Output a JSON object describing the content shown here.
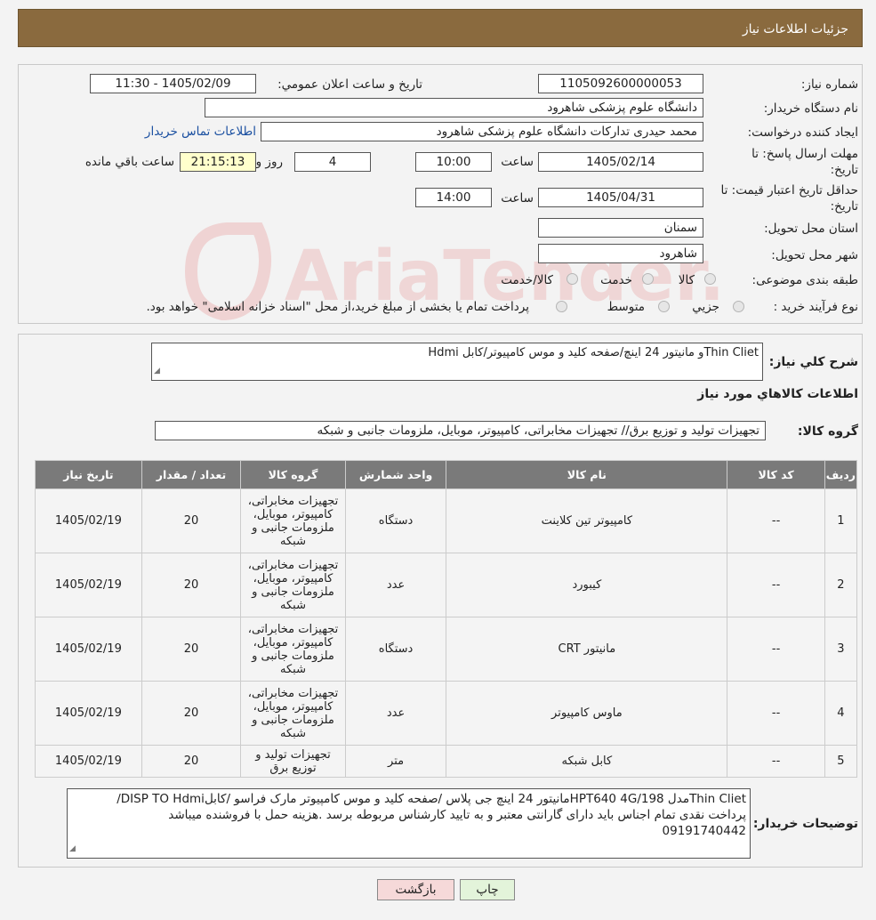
{
  "header": {
    "title": "جزئیات اطلاعات نیاز"
  },
  "form": {
    "need_number_label": "شماره نياز:",
    "need_number": "1105092600000053",
    "announce_label": "تاريخ و ساعت اعلان عمومي:",
    "announce_value": "1405/02/09 - 11:30",
    "buyer_org_label": "نام دستگاه خريدار:",
    "buyer_org": "دانشگاه علوم پزشکی شاهرود",
    "requester_label": "ايجاد کننده درخواست:",
    "requester": "محمد حیدری تدارکات دانشگاه علوم پزشکی شاهرود",
    "contact_link": "اطلاعات تماس خريدار",
    "deadline_label_1": "مهلت ارسال پاسخ: تا",
    "deadline_label_2": "تاريخ:",
    "deadline_date": "1405/02/14",
    "hour_label": "ساعت",
    "deadline_time": "10:00",
    "days_value": "4",
    "days_label": "روز و",
    "remaining_time": "21:15:13",
    "remaining_label": "ساعت باقي مانده",
    "validity_label_1": "حداقل تاريخ اعتبار قيمت: تا",
    "validity_label_2": "تاريخ:",
    "validity_date": "1405/04/31",
    "validity_time": "14:00",
    "province_label": "استان محل تحويل:",
    "province": "سمنان",
    "city_label": "شهر محل تحويل:",
    "city": "شاهرود",
    "category_label": "طبقه بندی موضوعی:",
    "category_options": [
      "کالا",
      "خدمت",
      "کالا/خدمت"
    ],
    "process_label": "نوع فرآيند خريد :",
    "process_options": [
      "جزيي",
      "متوسط"
    ],
    "process_note": "پرداخت تمام يا بخشی از مبلغ خريد،از محل \"اسناد خزانه اسلامی\" خواهد بود."
  },
  "summary": {
    "label": "شرح کلي نياز:",
    "text": "Thin Clietو مانیتور 24 اینچ/صفحه کلید و موس کامپیوتر/کابل Hdmi",
    "goods_info_title": "اطلاعات کالاهاي مورد نياز",
    "group_label": "گروه کالا:",
    "group_value": "تجهیزات تولید و توزیع برق// تجهیزات مخابراتی، کامپیوتر، موبایل، ملزومات جانبی و شبکه"
  },
  "table": {
    "headers": [
      "رديف",
      "کد کالا",
      "نام کالا",
      "واحد شمارش",
      "گروه کالا",
      "تعداد / مقدار",
      "تاريخ نياز"
    ],
    "rows": [
      {
        "row": "1",
        "code": "--",
        "name": "کامپیوتر تین کلاینت",
        "unit": "دستگاه",
        "group": "تجهیزات مخابراتی، کامپیوتر، موبایل، ملزومات جانبی و شبکه",
        "qty": "20",
        "date": "1405/02/19"
      },
      {
        "row": "2",
        "code": "--",
        "name": "کیبورد",
        "unit": "عدد",
        "group": "تجهیزات مخابراتی، کامپیوتر، موبایل، ملزومات جانبی و شبکه",
        "qty": "20",
        "date": "1405/02/19"
      },
      {
        "row": "3",
        "code": "--",
        "name": "مانیتور CRT",
        "unit": "دستگاه",
        "group": "تجهیزات مخابراتی، کامپیوتر، موبایل، ملزومات جانبی و شبکه",
        "qty": "20",
        "date": "1405/02/19"
      },
      {
        "row": "4",
        "code": "--",
        "name": "ماوس کامپیوتر",
        "unit": "عدد",
        "group": "تجهیزات مخابراتی، کامپیوتر، موبایل، ملزومات جانبی و شبکه",
        "qty": "20",
        "date": "1405/02/19"
      },
      {
        "row": "5",
        "code": "--",
        "name": "کابل شبکه",
        "unit": "متر",
        "group": "تجهیزات تولید و توزیع برق",
        "qty": "20",
        "date": "1405/02/19"
      }
    ]
  },
  "buyer_notes": {
    "label": "توضيحات خريدار:",
    "line1": "Thin Clietمدل HPT640 4G/198مانیتور 24 اینچ جی پلاس /صفحه کلید و موس کامپیوتر مارک فراسو /کابلDISP TO Hdmi/",
    "line2": "پرداخت نقدی تمام اجناس باید دارای گارانتی معتبر و به تایید کارشناس مربوطه برسد .هزینه حمل با فروشنده میباشد",
    "line3": "09191740442"
  },
  "buttons": {
    "print": "چاپ",
    "back": "بازگشت"
  },
  "watermark": {
    "text": "AriaTender.neT"
  },
  "colors": {
    "header": "#8a6a3e",
    "back_button": "#f6d9d9",
    "print_button": "#e3f4da",
    "link": "#1a4fa0"
  }
}
